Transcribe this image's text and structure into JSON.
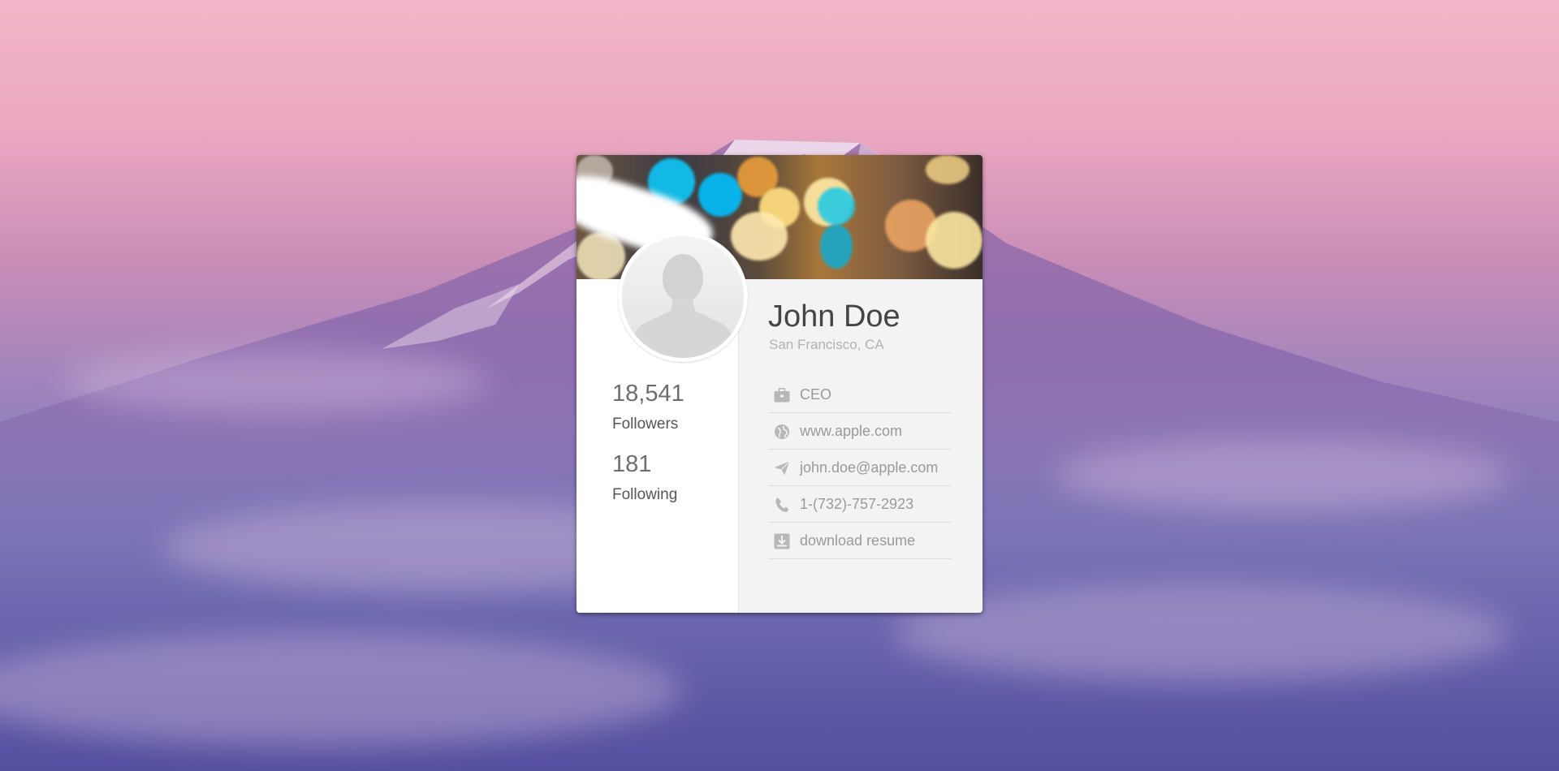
{
  "profile": {
    "name": "John Doe",
    "location": "San Francisco, CA"
  },
  "stats": {
    "followers_count": "18,541",
    "followers_label": "Followers",
    "following_count": "181",
    "following_label": "Following"
  },
  "info": {
    "items": [
      {
        "icon": "briefcase-icon",
        "text": "CEO"
      },
      {
        "icon": "globe-icon",
        "text": "www.apple.com"
      },
      {
        "icon": "send-icon",
        "text": "john.doe@apple.com"
      },
      {
        "icon": "phone-icon",
        "text": "1-(732)-757-2923"
      },
      {
        "icon": "download-icon",
        "text": "download resume"
      }
    ]
  },
  "colors": {
    "card_bg": "#f3f3f3",
    "left_panel_bg": "#ffffff",
    "name_text": "#444444",
    "muted_text": "#9a9a9a",
    "icon": "#b7b7b7"
  }
}
